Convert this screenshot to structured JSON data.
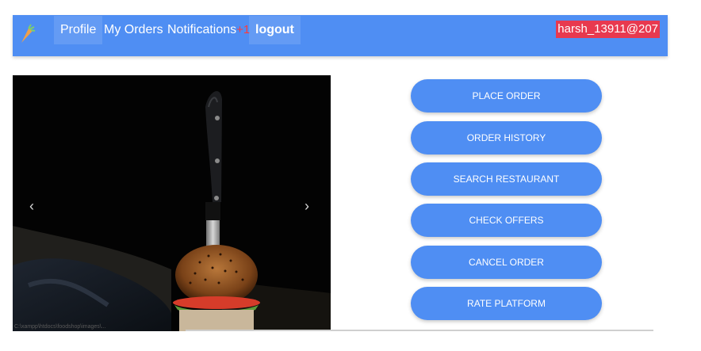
{
  "navbar": {
    "brand_icon": "carrot-logo-icon",
    "profile": "Profile",
    "my_orders": "My Orders",
    "notifications": "Notifications",
    "notifications_badge": "+1",
    "logout": "logout",
    "username": "harsh_13911@207"
  },
  "carousel": {
    "prev_label": "‹",
    "next_label": "›",
    "caption": "C:\\xampp\\htdocs\\foodshop\\images\\..."
  },
  "menu": {
    "buttons": [
      "PLACE ORDER",
      "ORDER HISTORY",
      "SEARCH RESTAURANT",
      "CHECK OFFERS",
      "CANCEL ORDER",
      "RATE PLATFORM"
    ]
  },
  "colors": {
    "primary": "#4f8ef3",
    "user_badge": "#e8394f",
    "notification_badge": "#ff3b3b"
  }
}
